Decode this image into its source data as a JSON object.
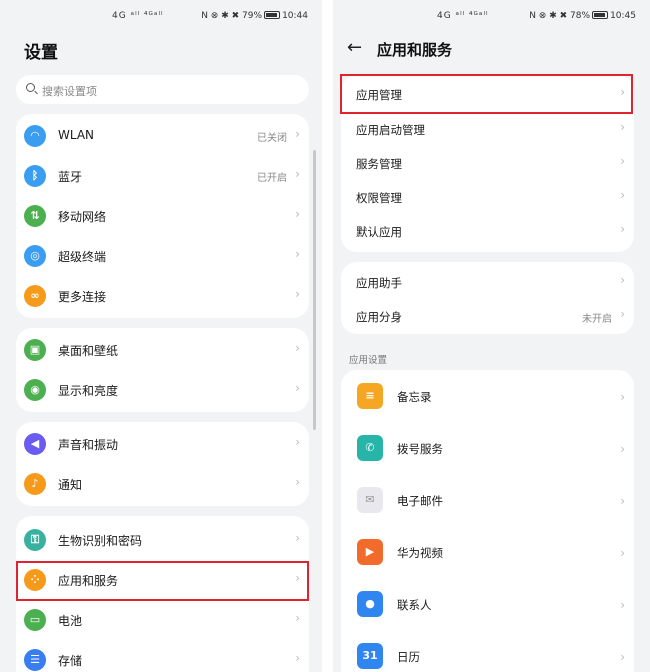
{
  "left": {
    "status": {
      "signal": "4G ᵃˡˡ ⁴ᴳᵃˡˡ",
      "right_icons": "N ⊗ ✱ ✖",
      "battery": "79%",
      "time": "10:44"
    },
    "title": "设置",
    "search": {
      "placeholder": "搜索设置项"
    },
    "items": [
      {
        "label": "WLAN",
        "value": "已关闭",
        "icon": "wifi-icon",
        "color": "#3a9df0"
      },
      {
        "label": "蓝牙",
        "value": "已开启",
        "icon": "bluetooth-icon",
        "color": "#3a9df0"
      },
      {
        "label": "移动网络",
        "icon": "mobile-network-icon",
        "color": "#4caf50"
      },
      {
        "label": "超级终端",
        "icon": "super-device-icon",
        "color": "#3a9df0"
      },
      {
        "label": "更多连接",
        "icon": "link-icon",
        "color": "#f59a1b"
      },
      {
        "label": "桌面和壁纸",
        "icon": "wallpaper-icon",
        "color": "#4caf50"
      },
      {
        "label": "显示和亮度",
        "icon": "display-icon",
        "color": "#4caf50"
      },
      {
        "label": "声音和振动",
        "icon": "sound-icon",
        "color": "#6b5cf0"
      },
      {
        "label": "通知",
        "icon": "bell-icon",
        "color": "#f59a1b"
      },
      {
        "label": "生物识别和密码",
        "icon": "key-icon",
        "color": "#3ab0a0"
      },
      {
        "label": "应用和服务",
        "icon": "apps-icon",
        "color": "#f59a1b"
      },
      {
        "label": "电池",
        "icon": "battery-icon",
        "color": "#4caf50"
      },
      {
        "label": "存储",
        "icon": "storage-icon",
        "color": "#3a7df0"
      }
    ]
  },
  "right": {
    "status": {
      "signal": "4G ᵃˡˡ ⁴ᴳᵃˡˡ",
      "right_icons": "N ⊗ ✱ ✖",
      "battery": "78%",
      "time": "10:45"
    },
    "title": "应用和服务",
    "group1": [
      "应用管理",
      "应用启动管理",
      "服务管理",
      "权限管理",
      "默认应用"
    ],
    "group2": [
      {
        "label": "应用助手",
        "value": ""
      },
      {
        "label": "应用分身",
        "value": "未开启"
      }
    ],
    "section_label": "应用设置",
    "apps": [
      {
        "label": "备忘录",
        "icon": "notepad-icon",
        "color": "#f5a623",
        "glyph": "≡"
      },
      {
        "label": "拨号服务",
        "icon": "phone-icon",
        "color": "#26b5a8",
        "glyph": "✆"
      },
      {
        "label": "电子邮件",
        "icon": "mail-icon",
        "color": "#e8e8ee",
        "glyph": "✉"
      },
      {
        "label": "华为视频",
        "icon": "video-icon",
        "color": "#f26b2a",
        "glyph": "▶"
      },
      {
        "label": "联系人",
        "icon": "contacts-icon",
        "color": "#2f86f0",
        "glyph": "●"
      },
      {
        "label": "日历",
        "icon": "calendar-icon",
        "color": "#2f86f0",
        "glyph": "31"
      }
    ]
  }
}
